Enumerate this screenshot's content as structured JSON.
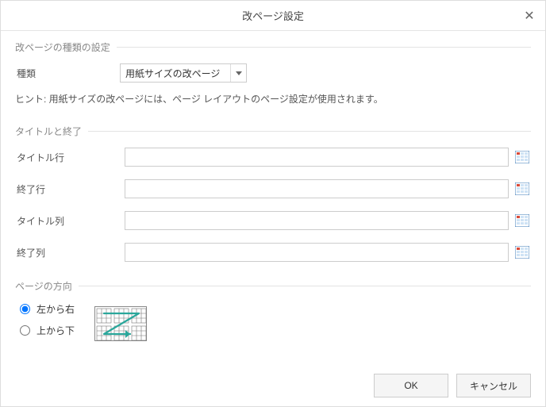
{
  "dialog": {
    "title": "改ページ設定",
    "close_glyph": "✕"
  },
  "section_type": {
    "group_label": "改ページの種類の設定",
    "type_label": "種類",
    "type_value": "用紙サイズの改ページ",
    "hint": "ヒント: 用紙サイズの改ページには、ページ レイアウトのページ設定が使用されます。"
  },
  "section_titles": {
    "group_label": "タイトルと終了",
    "title_row_label": "タイトル行",
    "end_row_label": "終了行",
    "title_col_label": "タイトル列",
    "end_col_label": "終了列",
    "title_row_value": "",
    "end_row_value": "",
    "title_col_value": "",
    "end_col_value": ""
  },
  "section_direction": {
    "group_label": "ページの方向",
    "left_to_right_label": "左から右",
    "top_to_bottom_label": "上から下",
    "selected": "left_to_right"
  },
  "footer": {
    "ok_label": "OK",
    "cancel_label": "キャンセル"
  }
}
